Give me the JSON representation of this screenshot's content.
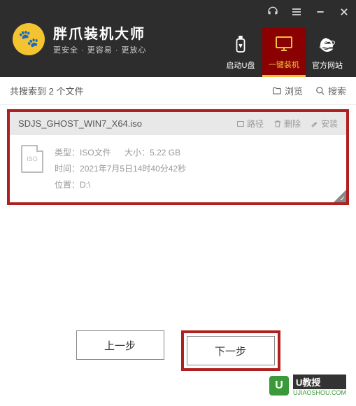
{
  "app": {
    "title": "胖爪装机大师",
    "subtitle": "更安全 · 更容易 · 更放心"
  },
  "nav": {
    "tabs": [
      {
        "label": "启动U盘"
      },
      {
        "label": "一键装机"
      },
      {
        "label": "官方网站"
      }
    ]
  },
  "toolbar": {
    "search_result": "共搜索到 2 个文件",
    "browse": "浏览",
    "search": "搜索"
  },
  "file": {
    "name": "SDJS_GHOST_WIN7_X64.iso",
    "actions": {
      "path": "路径",
      "delete": "删除",
      "install": "安装"
    },
    "icon_label": "ISO",
    "type_label": "类型：",
    "type_value": "ISO文件",
    "size_label": "大小：",
    "size_value": "5.22 GB",
    "time_label": "时间：",
    "time_value": "2021年7月5日14时40分42秒",
    "location_label": "位置：",
    "location_value": "D:\\"
  },
  "buttons": {
    "prev": "上一步",
    "next": "下一步"
  },
  "watermark": {
    "brand": "U教授",
    "url": "UJIAOSHOU.COM"
  }
}
